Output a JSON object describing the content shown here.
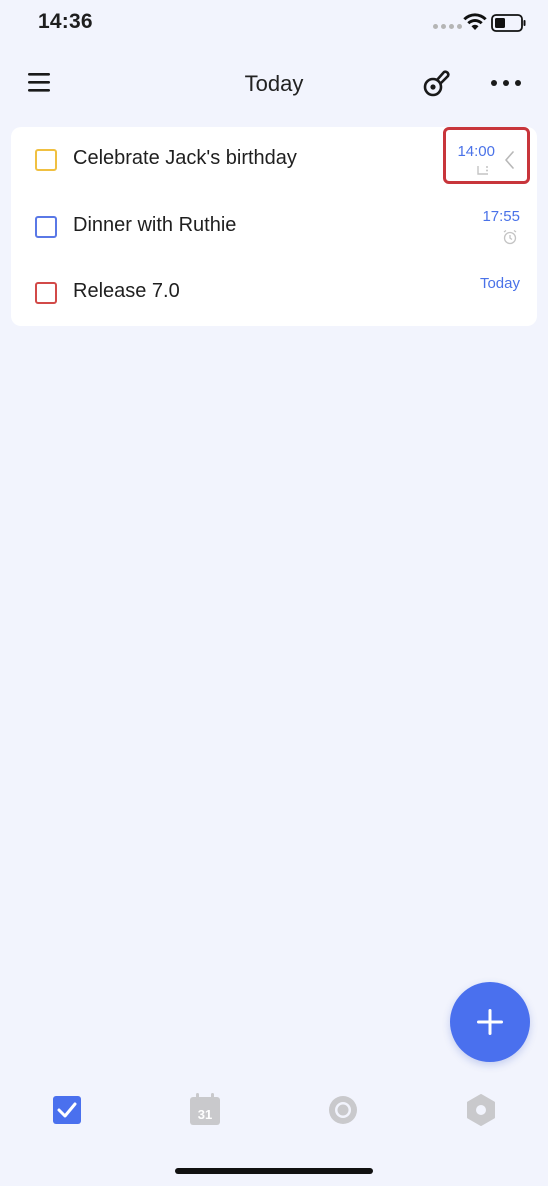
{
  "status_bar": {
    "time": "14:36"
  },
  "header": {
    "title": "Today"
  },
  "tasks": [
    {
      "title": "Celebrate Jack's birthday",
      "time": "14:00",
      "checkbox_color": "#f0c041",
      "sub_icon": "repeat-icon"
    },
    {
      "title": "Dinner with Ruthie",
      "time": "17:55",
      "checkbox_color": "#5a78e6",
      "sub_icon": "alarm-icon"
    },
    {
      "title": "Release 7.0",
      "time": "Today",
      "checkbox_color": "#d24a48",
      "sub_icon": ""
    }
  ],
  "colors": {
    "accent": "#4a70ee",
    "background": "#f2f4fd",
    "highlight": "#c8353b"
  },
  "tabbar": {
    "tabs": [
      "tasks-tab",
      "calendar-tab",
      "focus-tab",
      "settings-tab"
    ],
    "calendar_day": "31",
    "active": "tasks-tab"
  }
}
